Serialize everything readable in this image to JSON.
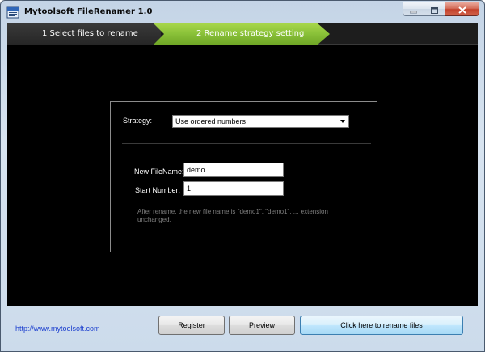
{
  "window": {
    "title": "Mytoolsoft FileRenamer 1.0",
    "icons": {
      "app": "file-renamer-icon",
      "minimize": "minimize-icon",
      "maximize": "maximize-icon",
      "close": "close-icon"
    }
  },
  "steps": [
    {
      "label": "1 Select files to rename",
      "active": false
    },
    {
      "label": "2 Rename strategy setting",
      "active": true
    }
  ],
  "settings": {
    "strategy_label": "Strategy:",
    "strategy_value": "Use ordered numbers",
    "new_filename_label": "New FileName:",
    "new_filename_value": "demo",
    "start_number_label": "Start Number:",
    "start_number_value": "1",
    "hint": "After rename, the new file name is \"demo1\", \"demo1\", ... extension unchanged."
  },
  "footer": {
    "website": "http://www.mytoolsoft.com",
    "register_label": "Register",
    "preview_label": "Preview",
    "rename_label": "Click here to rename files"
  },
  "colors": {
    "client_background": "#000000",
    "active_step": "#8cc33a",
    "link": "#1c3fcf",
    "hint_text": "#7e7e7e"
  }
}
